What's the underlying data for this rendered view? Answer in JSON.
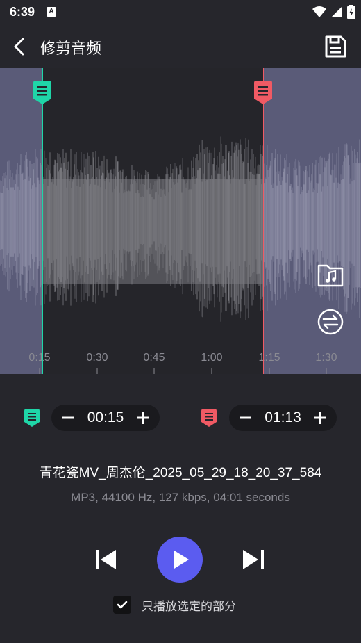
{
  "status_bar": {
    "time": "6:39",
    "notification_letter": "A"
  },
  "app_bar": {
    "title": "修剪音频"
  },
  "timeline": {
    "ticks": [
      "0:15",
      "0:30",
      "0:45",
      "1:00",
      "1:15",
      "1:30"
    ]
  },
  "start": {
    "time": "00:15"
  },
  "end": {
    "time": "01:13"
  },
  "file": {
    "name": "青花瓷MV_周杰伦_2025_05_29_18_20_37_584",
    "info": "MP3, 44100 Hz, 127 kbps, 04:01 seconds"
  },
  "playback": {
    "only_selected_label": "只播放选定的部分",
    "only_selected_checked": true
  },
  "colors": {
    "start_marker": "#1fd6a8",
    "end_marker": "#f05a64",
    "play_button": "#5b5cf0",
    "waveform": "#8a8a92",
    "outside_selection": "#5a5b78"
  }
}
